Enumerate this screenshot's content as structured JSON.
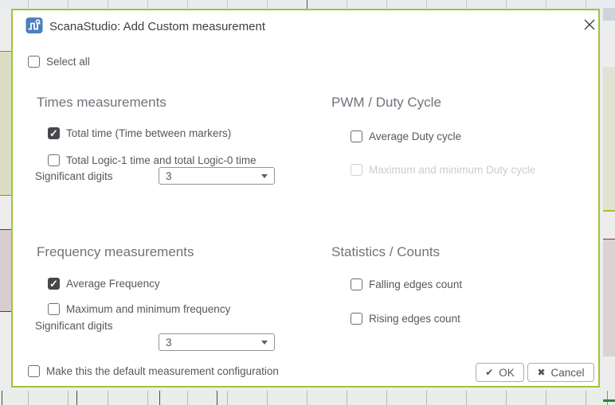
{
  "colors": {
    "dialog_border": "#9fc536",
    "checkbox_checked": "#48484c",
    "app_icon_blue": "#4d7fc0",
    "channel_olive": "#8b8b33",
    "channel_maroon": "#7c2b2b"
  },
  "window": {
    "title": "ScanaStudio: Add Custom measurement"
  },
  "select_all": {
    "label": "Select all",
    "checked": false
  },
  "sections": [
    {
      "title": "Times measurements",
      "items": [
        {
          "label": "Total time (Time between markers)",
          "checked": true
        },
        {
          "label": "Total Logic-1 time and total Logic-0 time",
          "checked": false
        }
      ],
      "significant_digits": {
        "label": "Significant digits",
        "value": "3"
      }
    },
    {
      "title": "PWM / Duty Cycle",
      "items": [
        {
          "label": "Average Duty cycle",
          "checked": false
        },
        {
          "label": "Maximum and minimum Duty cycle",
          "checked": false,
          "disabled": true
        }
      ]
    },
    {
      "title": "Frequency measurements",
      "items": [
        {
          "label": "Average Frequency",
          "checked": true
        },
        {
          "label": "Maximum and minimum frequency",
          "checked": false
        }
      ],
      "significant_digits": {
        "label": "Significant digits",
        "value": "3"
      }
    },
    {
      "title": "Statistics / Counts",
      "items": [
        {
          "label": "Falling edges count",
          "checked": false
        },
        {
          "label": "Rising edges count",
          "checked": false
        }
      ]
    }
  ],
  "footer": {
    "default_label": "Make this the default measurement configuration",
    "default_checked": false,
    "ok": {
      "label": "OK",
      "icon_glyph": "✔"
    },
    "cancel": {
      "label": "Cancel",
      "icon_glyph": "✖"
    }
  }
}
